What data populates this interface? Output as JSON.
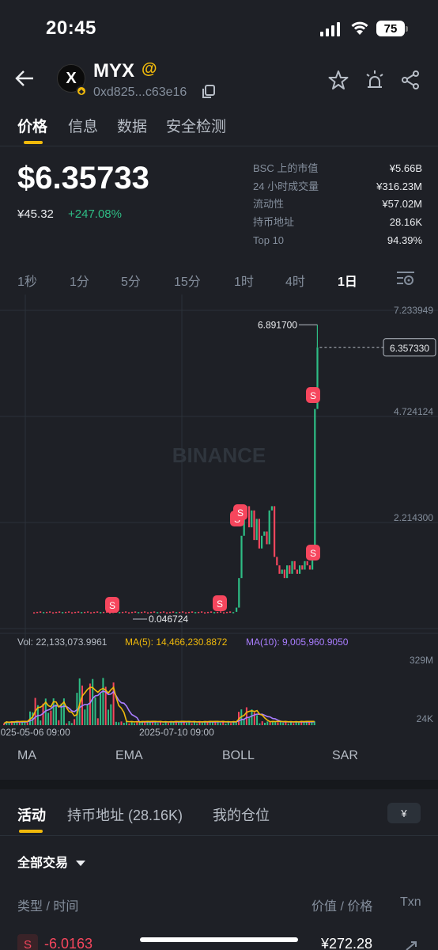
{
  "status_bar": {
    "time": "20:45",
    "battery": "75"
  },
  "header": {
    "token_name": "MYX",
    "alpha_symbol": "@",
    "contract": "0xd825...c63e16",
    "logo_glyph": "X"
  },
  "tabs": [
    {
      "label": "价格",
      "active": true
    },
    {
      "label": "信息",
      "active": false
    },
    {
      "label": "数据",
      "active": false
    },
    {
      "label": "安全检测",
      "active": false
    }
  ],
  "price": {
    "usd": "$6.35733",
    "cny": "¥45.32",
    "change": "+247.08%"
  },
  "stats": [
    {
      "k": "BSC 上的市值",
      "v": "¥5.66B"
    },
    {
      "k": "24 小时成交量",
      "v": "¥316.23M"
    },
    {
      "k": "流动性",
      "v": "¥57.02M"
    },
    {
      "k": "持币地址",
      "v": "28.16K"
    },
    {
      "k": "Top 10",
      "v": "94.39%"
    }
  ],
  "intervals": [
    {
      "label": "1秒",
      "active": false
    },
    {
      "label": "1分",
      "active": false
    },
    {
      "label": "5分",
      "active": false
    },
    {
      "label": "15分",
      "active": false
    },
    {
      "label": "1时",
      "active": false
    },
    {
      "label": "4时",
      "active": false
    },
    {
      "label": "1日",
      "active": true
    }
  ],
  "chart_data": {
    "type": "line",
    "watermark": "BINANCE",
    "y_ticks": [
      "7.233949",
      "4.724124",
      "2.214300"
    ],
    "y_tick_values": [
      7.233949,
      4.724124,
      2.2143
    ],
    "current_price_label": "6.357330",
    "current_price": 6.35733,
    "high_label": "6.891700",
    "high": 6.8917,
    "low_label": "0.046724",
    "low": 0.046724,
    "x_labels": [
      "2025-05-06 09:00",
      "2025-07-10 09:00"
    ],
    "sell_marker_label": "S",
    "volume": {
      "vol_label": "Vol: 22,133,073.9961",
      "ma5_label": "MA(5): 14,466,230.8872",
      "ma10_label": "MA(10): 9,005,960.9050",
      "y_ticks": [
        "329M",
        "24K"
      ]
    },
    "colors": {
      "up": "#2ebd85",
      "down": "#f6465d",
      "ma5": "#f0b90b",
      "ma10": "#a97dff"
    }
  },
  "indicators": [
    "MA",
    "EMA",
    "BOLL",
    "SAR"
  ],
  "activity": {
    "tabs": [
      {
        "label": "活动",
        "active": true
      },
      {
        "label": "持币地址 (28.16K)",
        "active": false
      },
      {
        "label": "我的仓位",
        "active": false
      }
    ],
    "currency": "¥",
    "filter": "全部交易",
    "col_type": "类型 / 时间",
    "col_value": "价值 / 价格",
    "col_txn": "Txn",
    "rows": [
      {
        "badge": "S",
        "amount": "-6.0163",
        "value": "¥272.28"
      }
    ]
  }
}
